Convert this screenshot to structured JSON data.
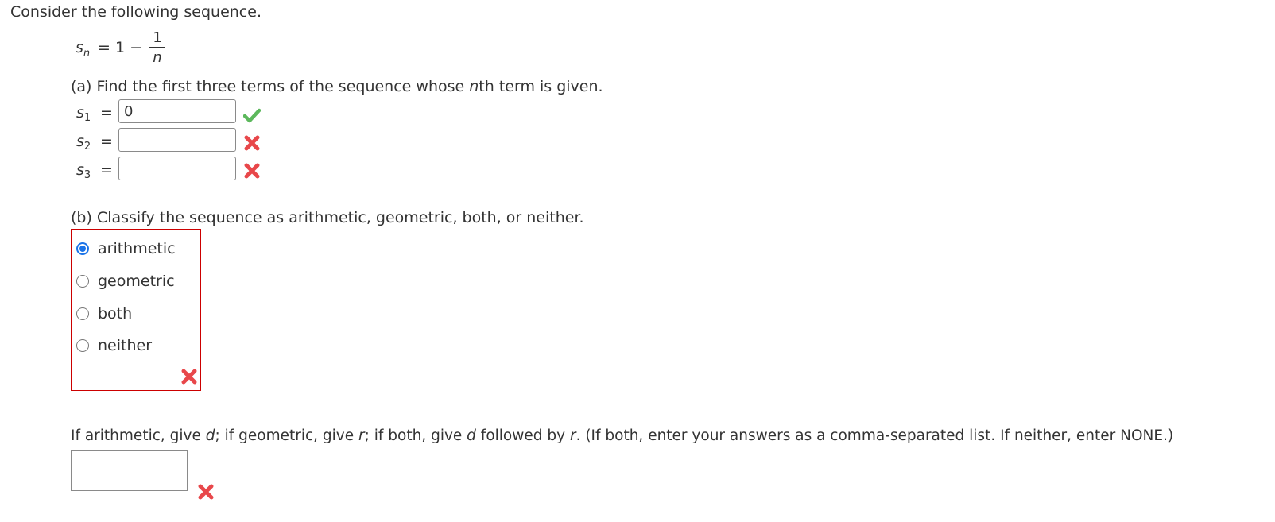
{
  "intro": "Consider the following sequence.",
  "formula": {
    "var": "s",
    "sub": "n",
    "rhs": "= 1 −",
    "numerator": "1",
    "denominator": "n"
  },
  "part_a": {
    "prompt_pre": "(a) Find the first three terms of the sequence whose ",
    "prompt_var": "n",
    "prompt_post": "th term is given.",
    "rows": [
      {
        "var": "s",
        "sub": "1",
        "eq": "=",
        "value": "0",
        "status": "correct"
      },
      {
        "var": "s",
        "sub": "2",
        "eq": "=",
        "value": "",
        "status": "incorrect"
      },
      {
        "var": "s",
        "sub": "3",
        "eq": "=",
        "value": "",
        "status": "incorrect"
      }
    ]
  },
  "part_b": {
    "prompt": "(b) Classify the sequence as arithmetic, geometric, both, or neither.",
    "options": [
      {
        "label": "arithmetic",
        "selected": true
      },
      {
        "label": "geometric",
        "selected": false
      },
      {
        "label": "both",
        "selected": false
      },
      {
        "label": "neither",
        "selected": false
      }
    ],
    "status": "incorrect"
  },
  "part_c": {
    "t1": "If arithmetic, give ",
    "v1": "d",
    "t2": "; if geometric, give ",
    "v2": "r",
    "t3": "; if both, give ",
    "v3": "d",
    "t4": " followed by ",
    "v4": "r",
    "t5": ". (If both, enter your answers as a comma-separated list. If neither, enter NONE.)",
    "value": "",
    "status": "incorrect"
  },
  "colors": {
    "correct": "#5cb85c",
    "incorrect": "#e8474a",
    "error_border": "#cc0000",
    "radio_selected": "#1a73e8"
  }
}
